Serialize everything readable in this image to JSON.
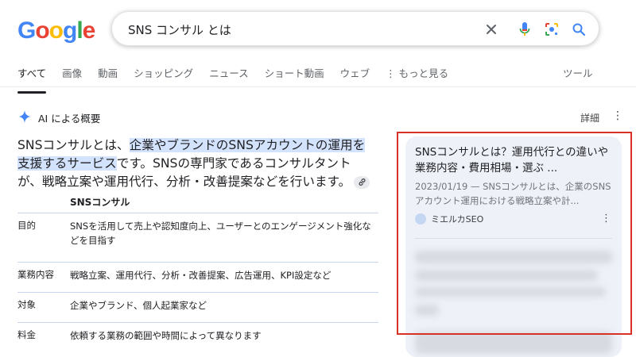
{
  "logo": {
    "text": "Google"
  },
  "search": {
    "query": "SNS コンサル とは"
  },
  "tabs": [
    {
      "label": "すべて"
    },
    {
      "label": "画像"
    },
    {
      "label": "動画"
    },
    {
      "label": "ショッピング"
    },
    {
      "label": "ニュース"
    },
    {
      "label": "ショート動画"
    },
    {
      "label": "ウェブ"
    },
    {
      "label": "もっと見る"
    }
  ],
  "tools_label": "ツール",
  "ai": {
    "title": "AI による概要",
    "detail_label": "詳細",
    "summary": {
      "lead": "SNSコンサルとは、",
      "highlight": "企業やブランドのSNSアカウントの運用を支援するサービス",
      "rest": "です。SNSの専門家であるコンサルタントが、戦略立案や運用代行、分析・改善提案などを行います。"
    },
    "table": {
      "header": "SNSコンサル",
      "rows": [
        {
          "k": "目的",
          "v": "SNSを活用して売上や認知度向上、ユーザーとのエンゲージメント強化などを目指す"
        },
        {
          "k": "業務内容",
          "v": "戦略立案、運用代行、分析・改善提案、広告運用、KPI設定など"
        },
        {
          "k": "対象",
          "v": "企業やブランド、個人起業家など"
        },
        {
          "k": "料金",
          "v": "依頼する業務の範囲や時間によって異なります"
        }
      ]
    }
  },
  "card": {
    "title": "SNSコンサルとは？運用代行との違いや業務内容・費用相場・選ぶ ...",
    "snippet": "2023/01/19 — SNSコンサルとは、企業のSNSアカウント運用における戦略立案や計...",
    "source": "ミエルカSEO"
  },
  "colors": {
    "accent": "#d93025",
    "highlight": "#d3e3fd",
    "card_bg": "#eef1f8"
  }
}
